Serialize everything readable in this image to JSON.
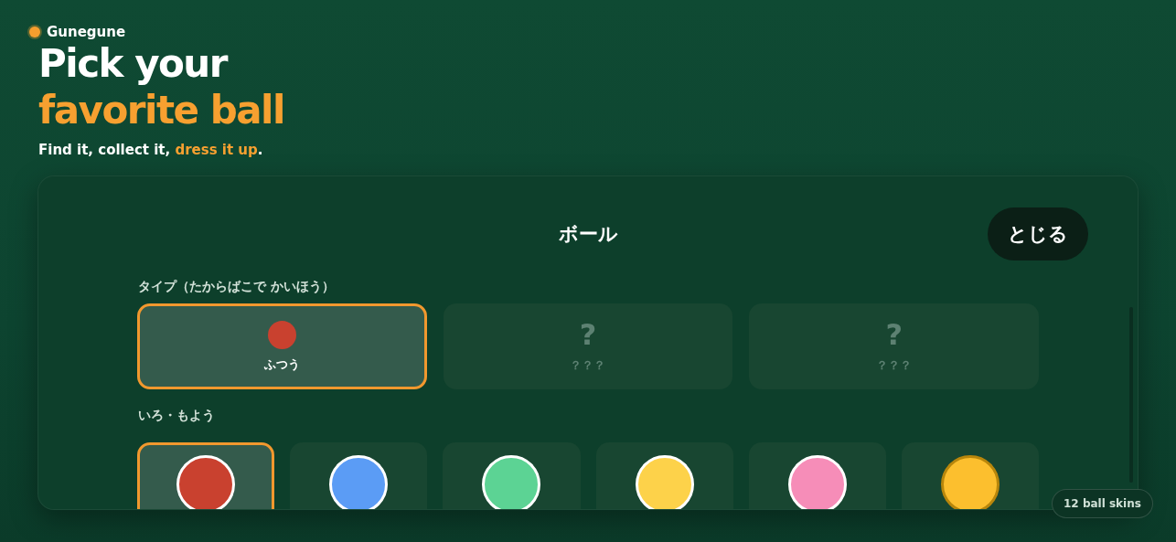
{
  "brand": {
    "name": "Gunegune"
  },
  "headline": {
    "line_1": "Pick your",
    "line_2": "favorite ball"
  },
  "tagline": {
    "text": "Find it, collect it, **dress it up**."
  },
  "panel": {
    "title": "ボール",
    "close_button": "とじる",
    "type_section": {
      "label": "タイプ（たからばこで かいほう）",
      "types": [
        {
          "label": "ふつう",
          "locked": false,
          "selected": true,
          "color": "#c9412f"
        },
        {
          "label": "？？？",
          "icon": "?",
          "locked": true,
          "selected": false
        },
        {
          "label": "？？？",
          "icon": "?",
          "locked": true,
          "selected": false
        }
      ]
    },
    "skin_section": {
      "label": "いろ・もよう",
      "skins": [
        {
          "color": "#c9412f",
          "kind": "plain",
          "selected": true
        },
        {
          "color": "#5b9cf5",
          "kind": "plain",
          "selected": false
        },
        {
          "color": "#5cd394",
          "kind": "plain",
          "selected": false
        },
        {
          "color": "#fdd24a",
          "kind": "plain",
          "selected": false
        },
        {
          "color": "#f68db8",
          "kind": "plain",
          "selected": false
        },
        {
          "color": "#fcbf2e",
          "kind": "gold",
          "selected": false
        }
      ]
    }
  },
  "skin_count_badge": "12 ball skins"
}
